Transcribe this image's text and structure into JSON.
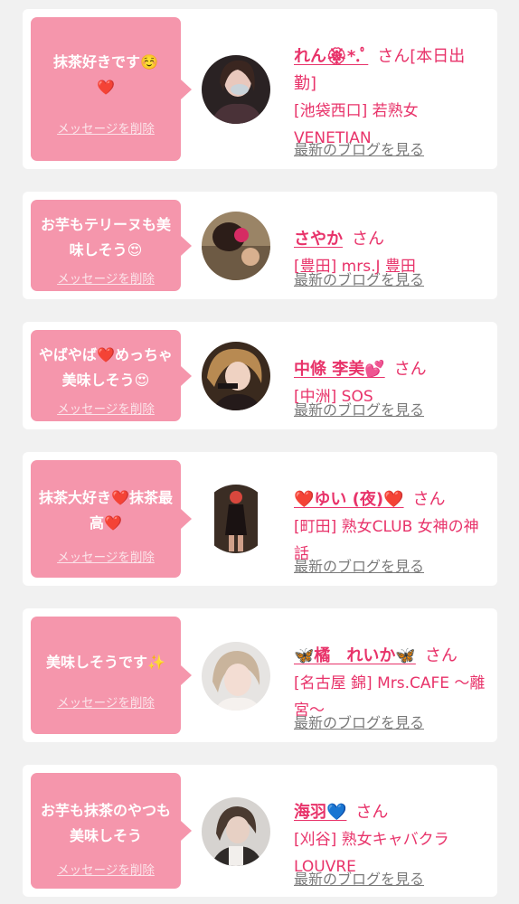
{
  "delete_label": "メッセージを削除",
  "san_label": "さん",
  "blog_label": "最新のブログを見る",
  "colors": {
    "page_bg": "#f1f1f1",
    "card_bg": "#ffffff",
    "bubble_bg": "#f596ac",
    "accent_pink": "#e8336a",
    "link_gray": "#7a7a7a"
  },
  "cards": [
    {
      "message": "抹茶好きです☺️\n❤️",
      "name": "れん🏵*.ﾟ",
      "name_suffix": "さん[本日出勤]",
      "shop": "[池袋西口] 若熟女 VENETIAN"
    },
    {
      "message": "お芋もテリーヌも美味しそう😍",
      "name": "さやか",
      "name_suffix": "さん",
      "shop": "[豊田] mrs.J 豊田"
    },
    {
      "message": "やばやば❤️めっちゃ美味しそう😍",
      "name": "中條 李美💕",
      "name_suffix": "さん",
      "shop": "[中洲] SOS"
    },
    {
      "message": "抹茶大好き❤️抹茶最高❤️",
      "name": "❤️ゆい (夜)❤️",
      "name_suffix": "さん",
      "shop": "[町田] 熟女CLUB 女神の神話"
    },
    {
      "message": "美味しそうです✨",
      "name": "🦋橘　れいか🦋",
      "name_suffix": "さん",
      "shop": "[名古屋 錦] Mrs.CAFE 〜離宮〜"
    },
    {
      "message": "お芋も抹茶のやつも美味しそう",
      "name": "海羽💙",
      "name_suffix": "さん",
      "shop": "[刈谷] 熟女キャバクラ LOUVRE"
    }
  ]
}
